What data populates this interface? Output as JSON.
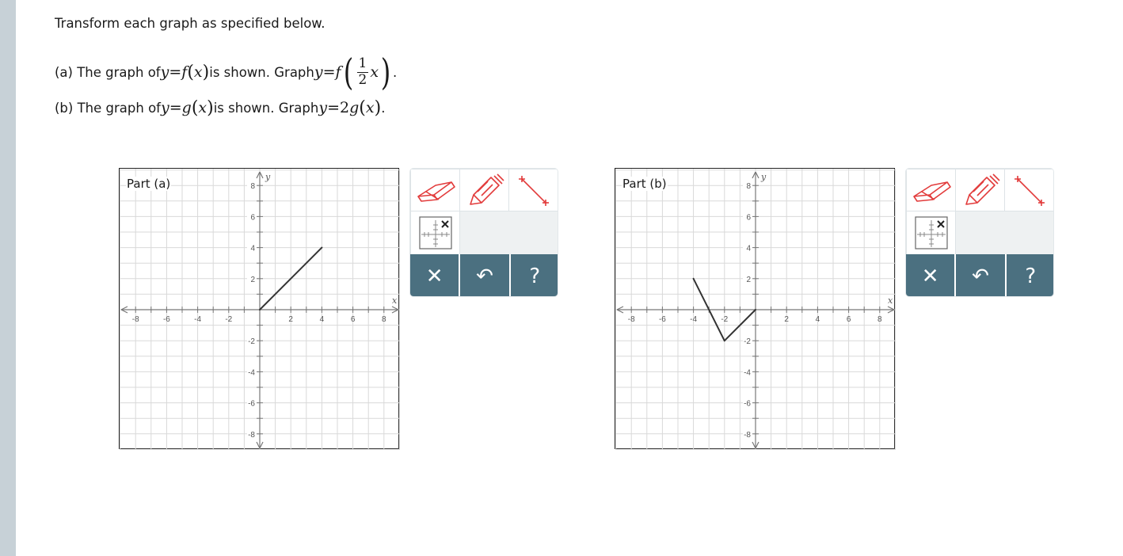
{
  "instruction": "Transform each graph as specified below.",
  "part_a": {
    "prefix": "(a) The graph of ",
    "given_fn": "f",
    "middle": " is shown. Graph ",
    "frac_num": "1",
    "frac_den": "2"
  },
  "part_b": {
    "prefix": "(b) The graph of ",
    "given_fn": "g",
    "middle": " is shown. Graph ",
    "coef": "2",
    "end": "."
  },
  "graphs": [
    {
      "label": "Part (a)",
      "x_axis_label": "x",
      "y_axis_label": "y",
      "range": [
        -8,
        8
      ],
      "x_ticks": [
        "-8",
        "-6",
        "-4",
        "-2",
        "2",
        "4",
        "6",
        "8"
      ],
      "y_ticks": [
        "8",
        "6",
        "4",
        "2",
        "-2",
        "-4",
        "-6",
        "-8"
      ],
      "segments": [
        [
          [
            0,
            0
          ],
          [
            4,
            4
          ]
        ]
      ]
    },
    {
      "label": "Part (b)",
      "x_axis_label": "x",
      "y_axis_label": "y",
      "range": [
        -8,
        8
      ],
      "x_ticks": [
        "-8",
        "-6",
        "-4",
        "-2",
        "2",
        "4",
        "6",
        "8"
      ],
      "y_ticks": [
        "8",
        "6",
        "4",
        "2",
        "-2",
        "-4",
        "-6",
        "-8"
      ],
      "segments": [
        [
          [
            -4,
            2
          ],
          [
            -2,
            -2
          ]
        ],
        [
          [
            -2,
            -2
          ],
          [
            0,
            0
          ]
        ]
      ]
    }
  ],
  "toolbox": {
    "tools": [
      "eraser-icon",
      "pencil-icon",
      "line-segment-icon",
      "clear-grid-icon"
    ],
    "accent_color": "#e23b3b",
    "bar_color": "#4b7080",
    "clear_symbol": "✕",
    "undo_symbol": "↶",
    "help_symbol": "?"
  }
}
